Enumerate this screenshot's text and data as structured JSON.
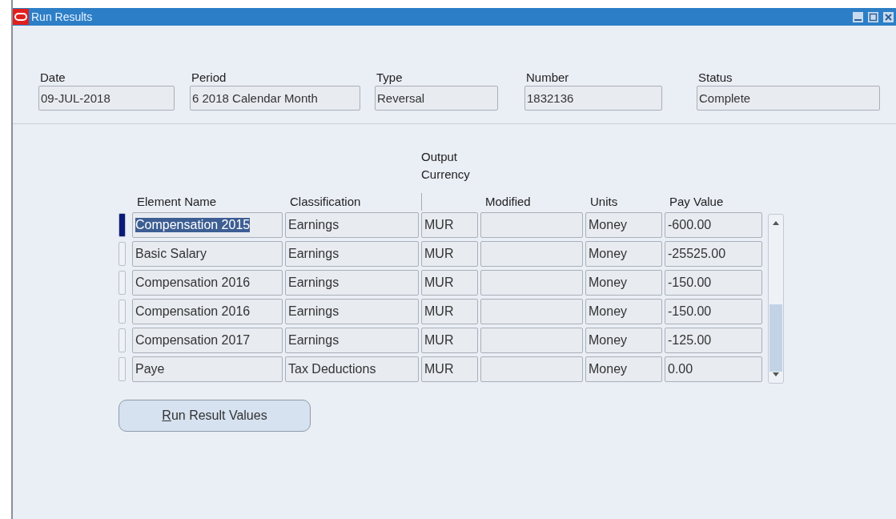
{
  "window": {
    "title": "Run Results"
  },
  "header_fields": [
    {
      "label": "Date",
      "value": "09-JUL-2018"
    },
    {
      "label": "Period",
      "value": "6 2018 Calendar Month"
    },
    {
      "label": "Type",
      "value": "Reversal"
    },
    {
      "label": "Number",
      "value": "1832136"
    },
    {
      "label": "Status",
      "value": "Complete"
    }
  ],
  "table": {
    "columns": [
      "Element Name",
      "Classification",
      "Output Currency",
      "Modified",
      "Units",
      "Pay Value"
    ],
    "rows": [
      {
        "selected": true,
        "cells": [
          "Compensation 2015",
          "Earnings",
          "MUR",
          "",
          "Money",
          "-600.00"
        ]
      },
      {
        "selected": false,
        "cells": [
          "Basic Salary",
          "Earnings",
          "MUR",
          "",
          "Money",
          "-25525.00"
        ]
      },
      {
        "selected": false,
        "cells": [
          "Compensation 2016",
          "Earnings",
          "MUR",
          "",
          "Money",
          "-150.00"
        ]
      },
      {
        "selected": false,
        "cells": [
          "Compensation 2016",
          "Earnings",
          "MUR",
          "",
          "Money",
          "-150.00"
        ]
      },
      {
        "selected": false,
        "cells": [
          "Compensation 2017",
          "Earnings",
          "MUR",
          "",
          "Money",
          "-125.00"
        ]
      },
      {
        "selected": false,
        "cells": [
          "Paye",
          "Tax Deductions",
          "MUR",
          "",
          "Money",
          "0.00"
        ]
      }
    ]
  },
  "button": {
    "label": "Run Result Values",
    "mnemonic_underlined": true
  }
}
